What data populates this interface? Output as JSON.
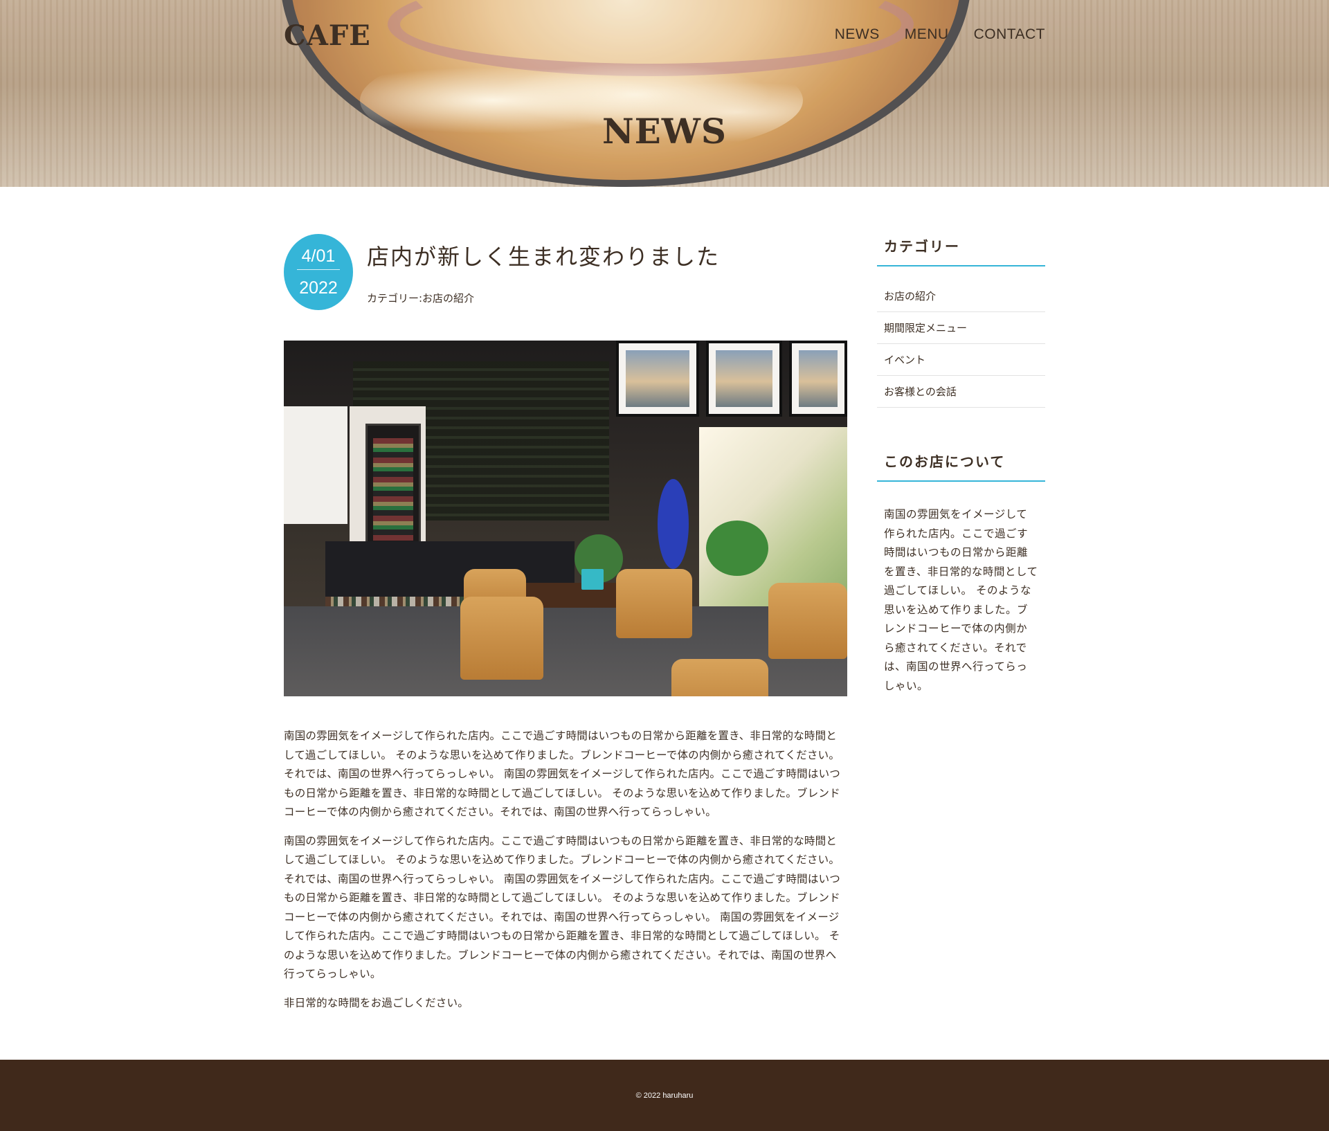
{
  "header": {
    "logo": "CAFE",
    "nav": [
      "NEWS",
      "MENU",
      "CONTACT"
    ],
    "page_title": "NEWS"
  },
  "post": {
    "date_md": "4/01",
    "date_year": "2022",
    "title": "店内が新しく生まれ変わりました",
    "category": "カテゴリー:お店の紹介",
    "paragraphs": [
      "南国の雰囲気をイメージして作られた店内。ここで過ごす時間はいつもの日常から距離を置き、非日常的な時間として過ごしてほしい。 そのような思いを込めて作りました。ブレンドコーヒーで体の内側から癒されてください。それでは、南国の世界へ行ってらっしゃい。 南国の雰囲気をイメージして作られた店内。ここで過ごす時間はいつもの日常から距離を置き、非日常的な時間として過ごしてほしい。 そのような思いを込めて作りました。ブレンドコーヒーで体の内側から癒されてください。それでは、南国の世界へ行ってらっしゃい。",
      "南国の雰囲気をイメージして作られた店内。ここで過ごす時間はいつもの日常から距離を置き、非日常的な時間として過ごしてほしい。 そのような思いを込めて作りました。ブレンドコーヒーで体の内側から癒されてください。それでは、南国の世界へ行ってらっしゃい。 南国の雰囲気をイメージして作られた店内。ここで過ごす時間はいつもの日常から距離を置き、非日常的な時間として過ごしてほしい。 そのような思いを込めて作りました。ブレンドコーヒーで体の内側から癒されてください。それでは、南国の世界へ行ってらっしゃい。 南国の雰囲気をイメージして作られた店内。ここで過ごす時間はいつもの日常から距離を置き、非日常的な時間として過ごしてほしい。 そのような思いを込めて作りました。ブレンドコーヒーで体の内側から癒されてください。それでは、南国の世界へ行ってらっしゃい。",
      "非日常的な時間をお過ごしください。"
    ]
  },
  "sidebar": {
    "category_title": "カテゴリー",
    "categories": [
      "お店の紹介",
      "期間限定メニュー",
      "イベント",
      "お客様との会話"
    ],
    "about_title": "このお店について",
    "about_text": "南国の雰囲気をイメージして作られた店内。ここで過ごす時間はいつもの日常から距離を置き、非日常的な時間として過ごしてほしい。 そのような思いを込めて作りました。ブレンドコーヒーで体の内側から癒されてください。それでは、南国の世界へ行ってらっしゃい。"
  },
  "footer": {
    "copyright": "© 2022 haruharu"
  },
  "colors": {
    "accent": "#35b5d8",
    "text": "#3d2f24",
    "footer_bg": "#40291b"
  }
}
